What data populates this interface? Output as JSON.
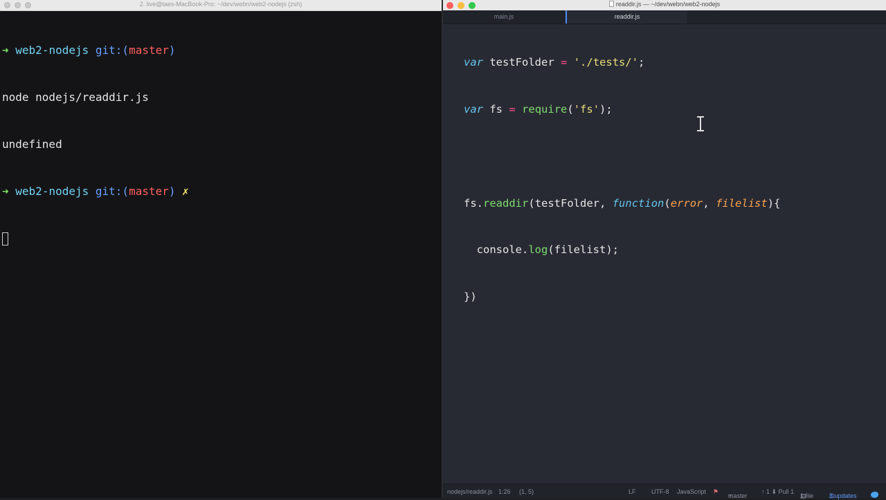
{
  "terminal": {
    "title": "2. live@taes-MacBook-Pro: ~/dev/webn/web2-nodejs (zsh)",
    "prompt_arrow": "➜",
    "prompt_dir": "web2-nodejs",
    "prompt_git_label": "git:(",
    "prompt_branch": "master",
    "prompt_git_close": ")",
    "dirty_mark": "✗",
    "command": "node nodejs/readdir.js",
    "output": "undefined"
  },
  "editor": {
    "window_title": "readdir.js — ~/dev/webn/web2-nodejs",
    "tabs": [
      {
        "label": "main.js",
        "active": false
      },
      {
        "label": "readdir.js",
        "active": true
      }
    ],
    "code": {
      "line1": {
        "kw": "var",
        "name": "testFolder",
        "op": "=",
        "str": "'./tests/'",
        "end": ";"
      },
      "line2": {
        "kw": "var",
        "name": "fs",
        "op": "=",
        "call": "require",
        "open": "(",
        "str": "'fs'",
        "end": ");"
      },
      "line4": {
        "obj": "fs",
        "dot": ".",
        "method": "readdir",
        "open": "(",
        "arg": "testFolder",
        "sep": ",",
        "fnkw": "function",
        "popen": "(",
        "p1": "error",
        "psep": ",",
        "p2": "filelist",
        "pclose": "){"
      },
      "line5": {
        "obj": "console",
        "dot": ".",
        "method": "log",
        "args": "(filelist);"
      },
      "line6": "})"
    },
    "status": {
      "file": "nodejs/readdir.js",
      "cursor": "1:26",
      "selection": "(1, 5)",
      "line_ending": "LF",
      "encoding": "UTF-8",
      "grammar": "JavaScript",
      "branch": "master",
      "push_pull": "↑ 1 ⬇ Pull 1",
      "files": "1 file",
      "updates": "3 updates"
    }
  },
  "colors": {
    "terminal_bg": "#141417",
    "editor_bg": "#282a33",
    "accent_blue": "#4f8cff"
  }
}
